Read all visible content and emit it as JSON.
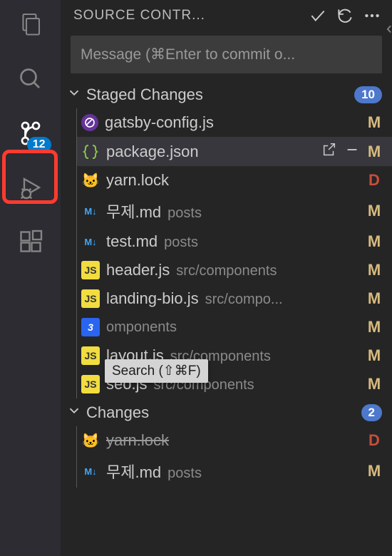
{
  "activityBar": {
    "items": [
      {
        "name": "explorer-icon"
      },
      {
        "name": "search-icon"
      },
      {
        "name": "source-control-icon",
        "badge": "12"
      },
      {
        "name": "run-debug-icon"
      },
      {
        "name": "extensions-icon"
      }
    ],
    "searchTooltip": "Search (⇧⌘F)"
  },
  "panel": {
    "title": "SOURCE CONTR...",
    "commitPlaceholder": "Message (⌘Enter to commit o...",
    "sections": [
      {
        "title": "Staged Changes",
        "count": "10",
        "files": [
          {
            "icon": "gatsby",
            "name": "gatsby-config.js",
            "path": "",
            "status": "M"
          },
          {
            "icon": "json",
            "name": "package.json",
            "path": "",
            "status": "M",
            "selected": true,
            "actions": true
          },
          {
            "icon": "lock",
            "name": "yarn.lock",
            "path": "",
            "status": "D"
          },
          {
            "icon": "md",
            "name": "무제.md",
            "path": "posts",
            "status": "M"
          },
          {
            "icon": "md",
            "name": "test.md",
            "path": "posts",
            "status": "M"
          },
          {
            "icon": "js",
            "name": "header.js",
            "path": "src/components",
            "status": "M"
          },
          {
            "icon": "js",
            "name": "landing-bio.js",
            "path": "src/compo...",
            "status": "M"
          },
          {
            "icon": "css",
            "name": "",
            "path": "omponents",
            "status": "M",
            "covered": true
          },
          {
            "icon": "js",
            "name": "layout.js",
            "path": "src/components",
            "status": "M"
          },
          {
            "icon": "js",
            "name": "seo.js",
            "path": "src/components",
            "status": "M"
          }
        ]
      },
      {
        "title": "Changes",
        "count": "2",
        "files": [
          {
            "icon": "lock",
            "name": "yarn.lock",
            "path": "",
            "status": "D",
            "strike": true
          },
          {
            "icon": "md",
            "name": "무제.md",
            "path": "posts",
            "status": "M"
          }
        ]
      }
    ]
  }
}
